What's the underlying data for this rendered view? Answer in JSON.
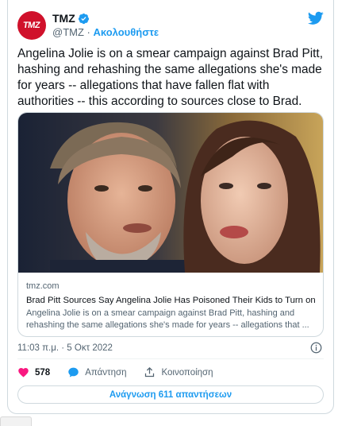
{
  "account": {
    "name": "TMZ",
    "avatar_text": "TMZ",
    "handle": "@TMZ",
    "separator": "·",
    "follow_label": "Ακολουθήστε"
  },
  "tweet": {
    "text": "Angelina Jolie is on a smear campaign against Brad Pitt, hashing and rehashing the same allegations she's made for years -- allegations that have fallen flat with authorities -- this according to sources close to Brad."
  },
  "link_card": {
    "domain": "tmz.com",
    "title": "Brad Pitt Sources Say Angelina Jolie Has Poisoned Their Kids to Turn on ...",
    "description": "Angelina Jolie is on a smear campaign against Brad Pitt, hashing and rehashing the same allegations she's made for years -- allegations that ..."
  },
  "meta": {
    "timestamp": "11:03 π.μ. · 5 Οκτ 2022"
  },
  "actions": {
    "like_count": "578",
    "reply_label": "Απάντηση",
    "share_label": "Κοινοποίηση"
  },
  "replies_button": "Ανάγνωση 611 απαντήσεων",
  "colors": {
    "accent": "#1d9bf0",
    "like": "#f91880",
    "brand": "#d0112b"
  },
  "icons": [
    "verified-badge-icon",
    "twitter-bird-icon",
    "info-icon",
    "heart-icon",
    "reply-icon",
    "share-icon"
  ]
}
